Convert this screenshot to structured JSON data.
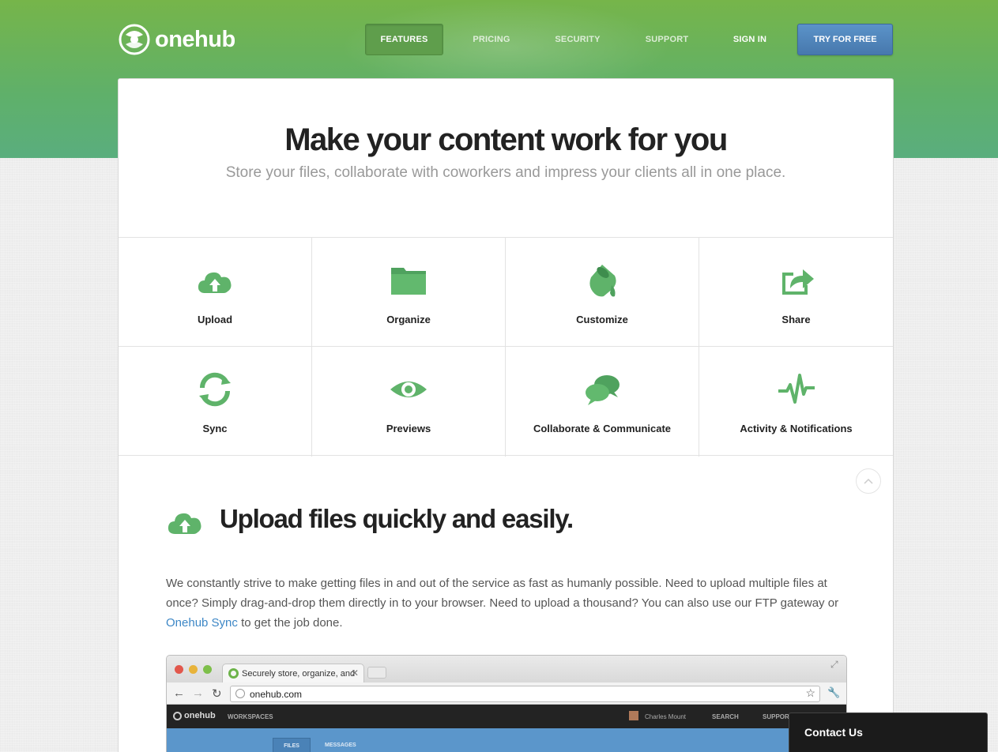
{
  "brand": {
    "name": "onehub",
    "accent": "#6bb04e",
    "button_blue": "#4f85bb"
  },
  "nav": {
    "items": [
      {
        "label": "FEATURES",
        "active": true
      },
      {
        "label": "PRICING"
      },
      {
        "label": "SECURITY"
      },
      {
        "label": "SUPPORT"
      },
      {
        "label": "SIGN IN"
      }
    ],
    "cta": "TRY FOR FREE"
  },
  "hero": {
    "title": "Make your content work for you",
    "subtitle": "Store your files, collaborate with coworkers and impress your clients all in one place."
  },
  "features": [
    {
      "label": "Upload",
      "icon": "cloud-upload-icon"
    },
    {
      "label": "Organize",
      "icon": "folder-icon"
    },
    {
      "label": "Customize",
      "icon": "paint-bucket-icon"
    },
    {
      "label": "Share",
      "icon": "share-icon"
    },
    {
      "label": "Sync",
      "icon": "sync-icon"
    },
    {
      "label": "Previews",
      "icon": "eye-icon"
    },
    {
      "label": "Collaborate & Communicate",
      "icon": "chat-bubbles-icon"
    },
    {
      "label": "Activity & Notifications",
      "icon": "pulse-icon"
    }
  ],
  "section": {
    "title": "Upload files quickly and easily.",
    "body_before": "We constantly strive to make getting files in and out of the service as fast as humanly possible. Need to upload multiple files at once? Simply drag-and-drop them directly in to your browser. Need to upload a thousand? You can also use our FTP gateway or ",
    "link": "Onehub Sync",
    "body_after": " to get the job done."
  },
  "screenshot": {
    "tab_title": "Securely store, organize, and",
    "url": "onehub.com",
    "app_logo": "onehub",
    "workspaces": "WORKSPACES",
    "user": "Charles Mount",
    "search": "SEARCH",
    "support": "SUPPORT",
    "files_tab": "FILES",
    "messages_tab": "MESSAGES"
  },
  "contact": {
    "label": "Contact Us"
  }
}
